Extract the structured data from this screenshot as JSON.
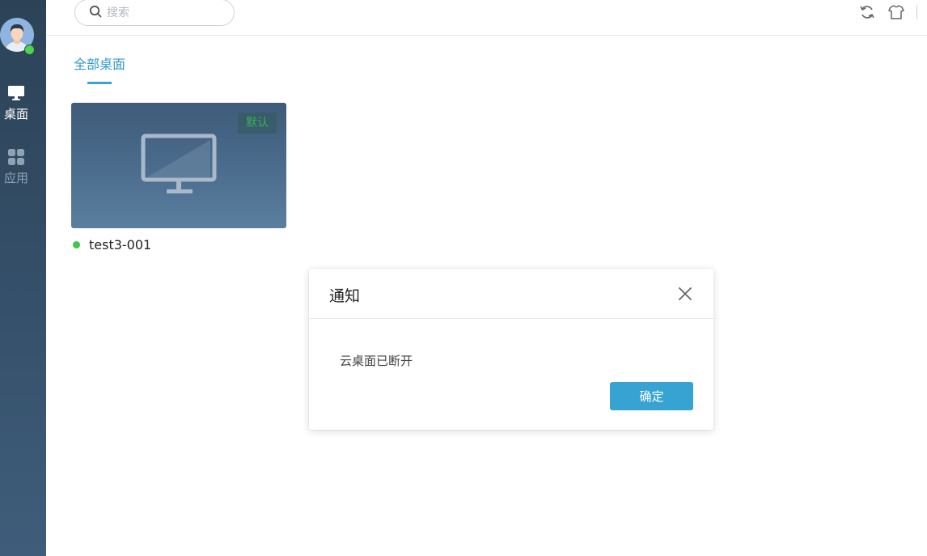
{
  "sidebar": {
    "status_color": "#4cd44c",
    "items": [
      {
        "label": "桌面",
        "icon": "monitor-icon",
        "active": true
      },
      {
        "label": "应用",
        "icon": "apps-grid-icon",
        "active": false
      }
    ]
  },
  "topbar": {
    "search": {
      "placeholder": "搜索",
      "value": "",
      "icon": "search-icon"
    },
    "icons": [
      "refresh-icon",
      "shirt-icon"
    ]
  },
  "tabs": [
    {
      "label": "全部桌面",
      "active": true
    }
  ],
  "desktops": [
    {
      "name": "test3-001",
      "badge": "默认",
      "status": "online",
      "status_color": "#3cc849"
    }
  ],
  "dialog": {
    "title": "通知",
    "message": "云桌面已断开",
    "confirm_label": "确定",
    "close_icon": "close-icon"
  },
  "colors": {
    "accent": "#37a3d2",
    "sidebar": "#2c4357",
    "tab_active": "#3399cc"
  }
}
